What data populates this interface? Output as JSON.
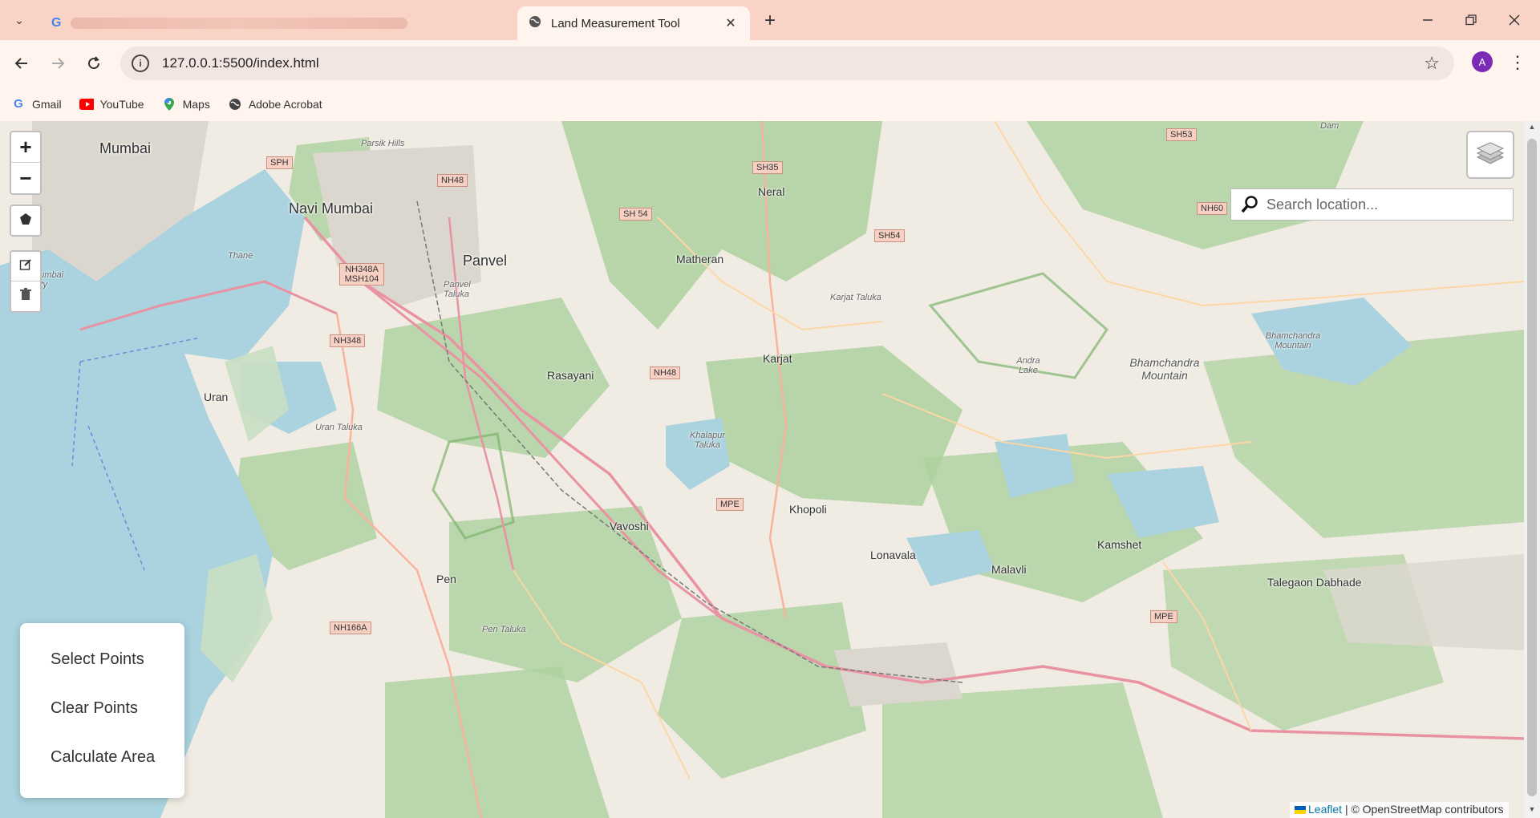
{
  "browser": {
    "tabs": [
      {
        "title": "",
        "favicon": "google-icon",
        "active": false
      },
      {
        "title": "Land Measurement Tool",
        "favicon": "globe-icon",
        "active": true
      }
    ],
    "close_glyph": "✕",
    "new_tab_glyph": "+",
    "url": "127.0.0.1:5500/index.html",
    "avatar_letter": "A",
    "accent_color": "#f9d3c6"
  },
  "bookmarks": [
    {
      "label": "Gmail",
      "icon": "google-icon"
    },
    {
      "label": "YouTube",
      "icon": "youtube-icon"
    },
    {
      "label": "Maps",
      "icon": "maps-pin-icon"
    },
    {
      "label": "Adobe Acrobat",
      "icon": "globe-icon"
    }
  ],
  "map": {
    "zoom_in": "+",
    "zoom_out": "−",
    "search_placeholder": "Search location...",
    "labels": {
      "mumbai": "Mumbai",
      "navi_mumbai": "Navi Mumbai",
      "panvel": "Panvel",
      "matheran": "Matheran",
      "neral": "Neral",
      "karjat": "Karjat",
      "rasayani": "Rasayani",
      "uran": "Uran",
      "khopoli": "Khopoli",
      "lonavala": "Lonavala",
      "malavli": "Malavli",
      "kamshet": "Kamshet",
      "talegaon": "Talegaon Dabhade",
      "vavoshi": "Vavoshi",
      "pen": "Pen",
      "bhamchandra": "Bhamchandra Mountain",
      "bhamchandra_small": "Bhamchandra Mountain",
      "parsik": "Parsik Hills",
      "thane": "Thane",
      "mumbai_city": "Mumbai City",
      "panvel_taluka": "Panvel Taluka",
      "karjat_taluka": "Karjat Taluka",
      "uran_taluka": "Uran Taluka",
      "khalapur_taluka": "Khalapur Taluka",
      "pen_taluka": "Pen Taluka",
      "andra_lake": "Andra Lake",
      "dam": "Dam"
    },
    "shields": {
      "sph": "SPH",
      "nh48_top": "NH48",
      "sh35": "SH35",
      "sh54a": "SH 54",
      "sh54b": "SH54",
      "sh53": "SH53",
      "nh60": "NH60",
      "nh348a": "NH348A MSH104",
      "nh348": "NH348",
      "nh48_mid": "NH48",
      "mpe1": "MPE",
      "mpe2": "MPE",
      "nh166a": "NH166A"
    }
  },
  "actions": {
    "select_points": "Select Points",
    "clear_points": "Clear Points",
    "calculate_area": "Calculate Area"
  },
  "attribution": {
    "leaflet": "Leaflet",
    "rest": "| © OpenStreetMap contributors"
  }
}
